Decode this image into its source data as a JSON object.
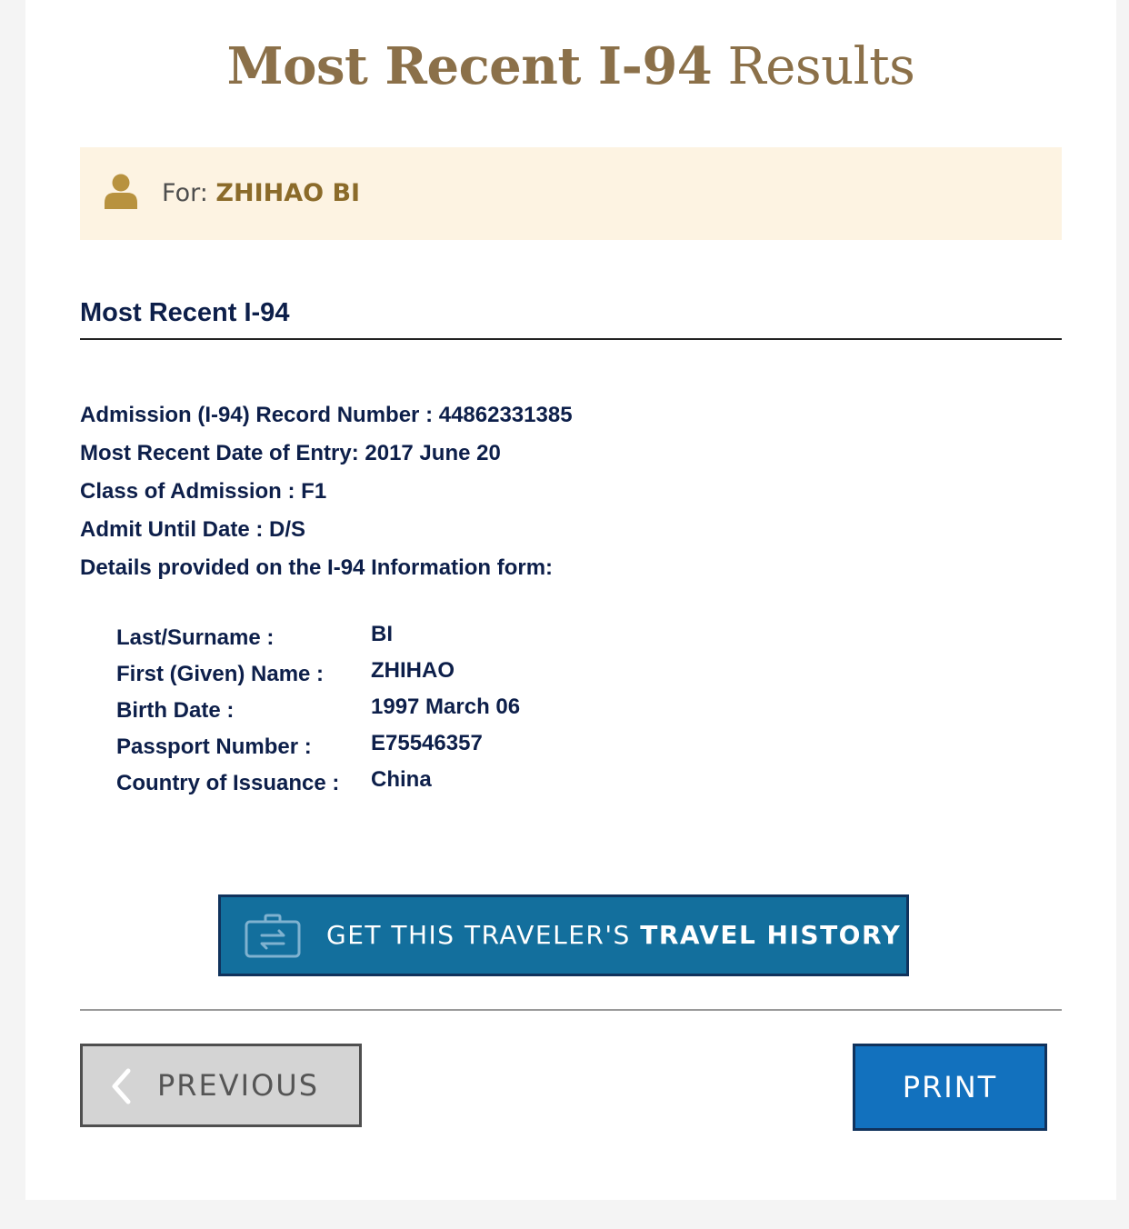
{
  "page_title": {
    "bold_part": "Most Recent I-94",
    "normal_part": " Results"
  },
  "banner": {
    "prefix": "For: ",
    "name": "ZHIHAO BI",
    "icon": "person-icon"
  },
  "section": {
    "heading": "Most Recent I-94"
  },
  "record": {
    "lines": [
      "Admission (I-94) Record Number : 44862331385",
      "Most Recent Date of Entry: 2017 June 20",
      "Class of Admission : F1",
      "Admit Until Date : D/S",
      "Details provided on the I-94 Information form:"
    ]
  },
  "details": [
    {
      "label": "Last/Surname :",
      "value": "BI"
    },
    {
      "label": "First (Given) Name :",
      "value": "ZHIHAO"
    },
    {
      "label": "Birth Date :",
      "value": "1997 March 06"
    },
    {
      "label": "Passport Number :",
      "value": "E75546357"
    },
    {
      "label": "Country of Issuance :",
      "value": "China"
    }
  ],
  "travel_history_button": {
    "normal_part": "GET THIS TRAVELER'S ",
    "bold_part": "TRAVEL HISTORY",
    "icon": "briefcase-transfer-icon"
  },
  "buttons": {
    "previous": "PREVIOUS",
    "print": "PRINT"
  },
  "colors": {
    "title_gold": "#8b7049",
    "banner_bg": "#fdf3e2",
    "navy_text": "#0d1f4a",
    "travel_button": "#136f9d",
    "print_button": "#1271be",
    "previous_button": "#d4d4d4"
  }
}
